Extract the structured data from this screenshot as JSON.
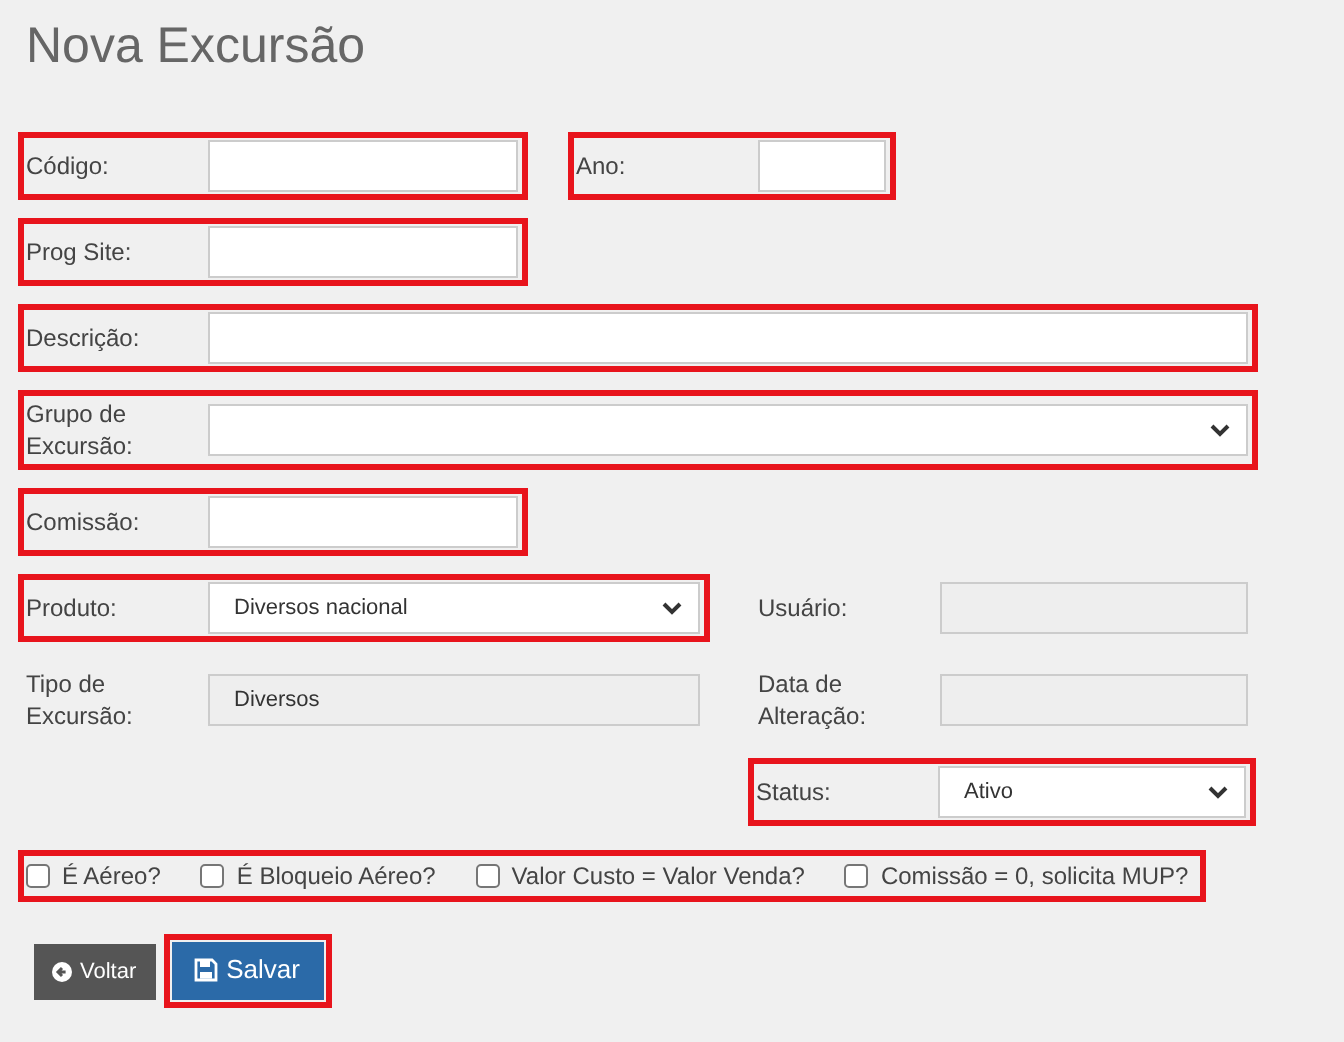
{
  "page_title": "Nova Excursão",
  "rows": [
    {
      "fields": [
        {
          "label": "Código:",
          "kind": "text",
          "highlighted": true
        },
        {
          "label": "Ano:",
          "kind": "text",
          "highlighted": true
        }
      ]
    },
    {
      "fields": [
        {
          "label": "Prog Site:",
          "kind": "text",
          "highlighted": true
        }
      ]
    },
    {
      "fields": [
        {
          "label": "Descrição:",
          "kind": "text",
          "highlighted": true
        }
      ]
    },
    {
      "fields": [
        {
          "label": "Grupo de Excursão:",
          "kind": "select",
          "highlighted": true
        }
      ]
    },
    {
      "fields": [
        {
          "label": "Comissão:",
          "kind": "text",
          "highlighted": true
        }
      ]
    },
    {
      "fields": [
        {
          "label": "Produto:",
          "kind": "select",
          "value": "Diversos nacional",
          "highlighted": true
        },
        {
          "label": "Usuário:",
          "kind": "readonly",
          "highlighted": false
        }
      ]
    },
    {
      "fields": [
        {
          "label": "Tipo de Excursão:",
          "kind": "readonly",
          "value": "Diversos",
          "highlighted": false
        },
        {
          "label": "Data de Alteração:",
          "kind": "readonly",
          "highlighted": false
        }
      ]
    },
    {
      "fields": [
        {
          "label": "Status:",
          "kind": "select",
          "value": "Ativo",
          "highlighted": true
        }
      ]
    }
  ],
  "options": {
    "highlighted": true,
    "items": [
      {
        "label": "É Aéreo?",
        "checked": false
      },
      {
        "label": "É Bloqueio Aéreo?",
        "checked": false
      },
      {
        "label": "Valor Custo = Valor Venda?",
        "checked": false
      },
      {
        "label": "Comissão = 0, solicita MUP?",
        "checked": false
      }
    ]
  },
  "buttons": [
    {
      "label": "Voltar",
      "kind": "back",
      "highlighted": false
    },
    {
      "label": "Salvar",
      "kind": "save",
      "highlighted": true
    }
  ]
}
